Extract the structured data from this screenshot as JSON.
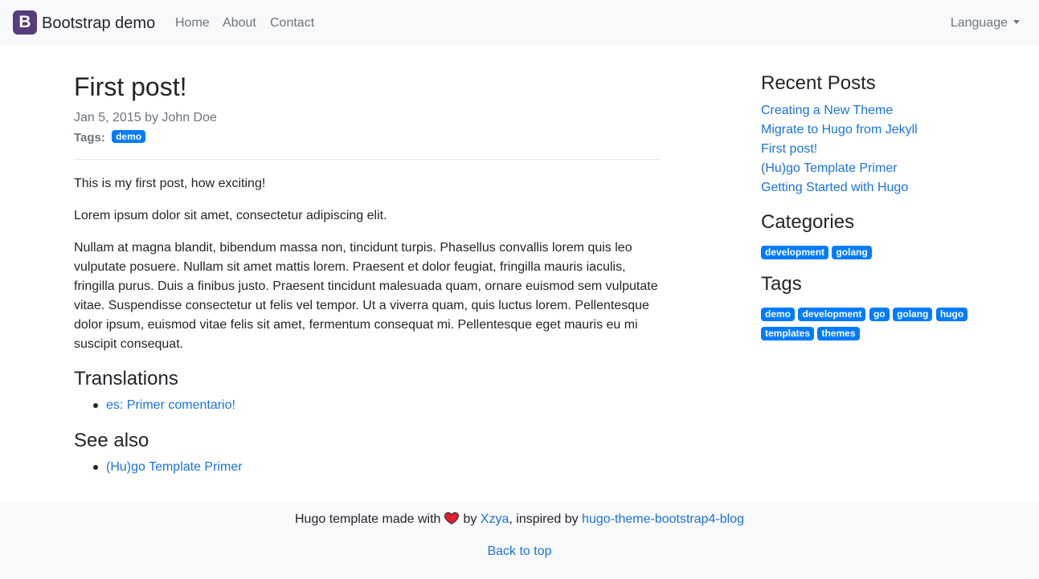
{
  "navbar": {
    "brand_letter": "B",
    "brand": "Bootstrap demo",
    "links": [
      "Home",
      "About",
      "Contact"
    ],
    "language": "Language"
  },
  "post": {
    "title": "First post!",
    "meta": "Jan 5, 2015 by John Doe",
    "tags_label": "Tags:",
    "tags": [
      "demo"
    ],
    "paragraphs": [
      "This is my first post, how exciting!",
      "Lorem ipsum dolor sit amet, consectetur adipiscing elit.",
      "Nullam at magna blandit, bibendum massa non, tincidunt turpis. Phasellus convallis lorem quis leo vulputate posuere. Nullam sit amet mattis lorem. Praesent et dolor feugiat, fringilla mauris iaculis, fringilla purus. Duis a finibus justo. Praesent tincidunt malesuada quam, ornare euismod sem vulputate vitae. Suspendisse consectetur ut felis vel tempor. Ut a viverra quam, quis luctus lorem. Pellentesque dolor ipsum, euismod vitae felis sit amet, fermentum consequat mi. Pellentesque eget mauris eu mi suscipit consequat."
    ],
    "translations_heading": "Translations",
    "translations": [
      "es: Primer comentario!"
    ],
    "see_also_heading": "See also",
    "see_also": [
      "(Hu)go Template Primer"
    ]
  },
  "sidebar": {
    "recent_heading": "Recent Posts",
    "recent": [
      "Creating a New Theme",
      "Migrate to Hugo from Jekyll",
      "First post!",
      "(Hu)go Template Primer",
      "Getting Started with Hugo"
    ],
    "categories_heading": "Categories",
    "categories": [
      "development",
      "golang"
    ],
    "tags_heading": "Tags",
    "tags": [
      "demo",
      "development",
      "go",
      "golang",
      "hugo",
      "templates",
      "themes"
    ]
  },
  "footer": {
    "made_with": "Hugo template made with",
    "by": "by",
    "author": "Xzya",
    "inspired": ", inspired by",
    "theme_link": "hugo-theme-bootstrap4-blog",
    "back_to_top": "Back to top"
  },
  "colors": {
    "link": "#1a73d9",
    "badge": "#007bff",
    "brand_logo": "#563d7c",
    "navbar_bg": "#f8f9fa",
    "heart": "#e0202f"
  },
  "icons": {
    "heart": "heart-icon",
    "caret": "chevron-down-icon"
  }
}
